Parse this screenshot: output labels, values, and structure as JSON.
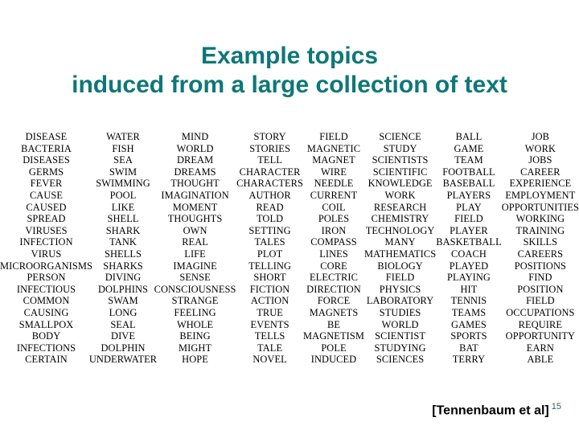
{
  "title": {
    "line_1": "Example topics",
    "line_2": "induced from a large collection of text",
    "color": "#0e7777"
  },
  "footer": {
    "citation": "[Tennenbaum et al]",
    "page_number": "15",
    "citation_color": "#000000",
    "page_number_color": "#31606a"
  },
  "topics": [
    {
      "id": "topic-disease",
      "words": [
        "DISEASE",
        "BACTERIA",
        "DISEASES",
        "GERMS",
        "FEVER",
        "CAUSE",
        "CAUSED",
        "SPREAD",
        "VIRUSES",
        "INFECTION",
        "VIRUS",
        "MICROORGANISMS",
        "PERSON",
        "INFECTIOUS",
        "COMMON",
        "CAUSING",
        "SMALLPOX",
        "BODY",
        "INFECTIONS",
        "CERTAIN"
      ]
    },
    {
      "id": "topic-water",
      "words": [
        "WATER",
        "FISH",
        "SEA",
        "SWIM",
        "SWIMMING",
        "POOL",
        "LIKE",
        "SHELL",
        "SHARK",
        "TANK",
        "SHELLS",
        "SHARKS",
        "DIVING",
        "DOLPHINS",
        "SWAM",
        "LONG",
        "SEAL",
        "DIVE",
        "DOLPHIN",
        "UNDERWATER"
      ]
    },
    {
      "id": "topic-mind",
      "words": [
        "MIND",
        "WORLD",
        "DREAM",
        "DREAMS",
        "THOUGHT",
        "IMAGINATION",
        "MOMENT",
        "THOUGHTS",
        "OWN",
        "REAL",
        "LIFE",
        "IMAGINE",
        "SENSE",
        "CONSCIOUSNESS",
        "STRANGE",
        "FEELING",
        "WHOLE",
        "BEING",
        "MIGHT",
        "HOPE"
      ]
    },
    {
      "id": "topic-story",
      "words": [
        "STORY",
        "STORIES",
        "TELL",
        "CHARACTER",
        "CHARACTERS",
        "AUTHOR",
        "READ",
        "TOLD",
        "SETTING",
        "TALES",
        "PLOT",
        "TELLING",
        "SHORT",
        "FICTION",
        "ACTION",
        "TRUE",
        "EVENTS",
        "TELLS",
        "TALE",
        "NOVEL"
      ]
    },
    {
      "id": "topic-field",
      "words": [
        "FIELD",
        "MAGNETIC",
        "MAGNET",
        "WIRE",
        "NEEDLE",
        "CURRENT",
        "COIL",
        "POLES",
        "IRON",
        "COMPASS",
        "LINES",
        "CORE",
        "ELECTRIC",
        "DIRECTION",
        "FORCE",
        "MAGNETS",
        "BE",
        "MAGNETISM",
        "POLE",
        "INDUCED"
      ]
    },
    {
      "id": "topic-science",
      "words": [
        "SCIENCE",
        "STUDY",
        "SCIENTISTS",
        "SCIENTIFIC",
        "KNOWLEDGE",
        "WORK",
        "RESEARCH",
        "CHEMISTRY",
        "TECHNOLOGY",
        "MANY",
        "MATHEMATICS",
        "BIOLOGY",
        "FIELD",
        "PHYSICS",
        "LABORATORY",
        "STUDIES",
        "WORLD",
        "SCIENTIST",
        "STUDYING",
        "SCIENCES"
      ]
    },
    {
      "id": "topic-ball",
      "words": [
        "BALL",
        "GAME",
        "TEAM",
        "FOOTBALL",
        "BASEBALL",
        "PLAYERS",
        "PLAY",
        "FIELD",
        "PLAYER",
        "BASKETBALL",
        "COACH",
        "PLAYED",
        "PLAYING",
        "HIT",
        "TENNIS",
        "TEAMS",
        "GAMES",
        "SPORTS",
        "BAT",
        "TERRY"
      ]
    },
    {
      "id": "topic-job",
      "words": [
        "JOB",
        "WORK",
        "JOBS",
        "CAREER",
        "EXPERIENCE",
        "EMPLOYMENT",
        "OPPORTUNITIES",
        "WORKING",
        "TRAINING",
        "SKILLS",
        "CAREERS",
        "POSITIONS",
        "FIND",
        "POSITION",
        "FIELD",
        "OCCUPATIONS",
        "REQUIRE",
        "OPPORTUNITY",
        "EARN",
        "ABLE"
      ]
    }
  ]
}
